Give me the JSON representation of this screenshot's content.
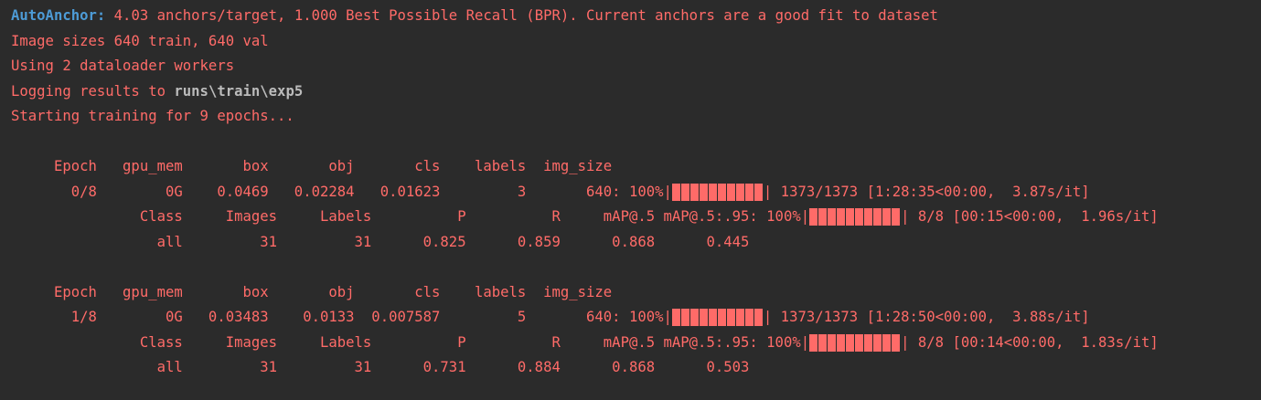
{
  "header": {
    "autoanchor_prefix": "AutoAnchor:",
    "autoanchor_msg": " 4.03 anchors/target, 1.000 Best Possible Recall (BPR). Current anchors are a good fit to dataset",
    "image_sizes": "Image sizes 640 train, 640 val",
    "workers": "Using 2 dataloader workers",
    "logging_prefix": "Logging results to ",
    "logging_path": "runs\\train\\exp5",
    "starting": "Starting training for 9 epochs..."
  },
  "epochs": [
    {
      "header_row": "     Epoch   gpu_mem       box       obj       cls    labels  img_size",
      "train_left": "       0/8        0G    0.0469   0.02284   0.01623         3       640: 100%|",
      "train_right": "| 1373/1373 [1:28:35<00:00,  3.87s/it]",
      "val_header_left": "               Class     Images     Labels          P          R     mAP@.5 mAP@.5:.95: 100%|",
      "val_header_right": "| 8/8 [00:15<00:00,  1.96s/it]",
      "val_row": "                 all         31         31      0.825      0.859      0.868      0.445"
    },
    {
      "header_row": "     Epoch   gpu_mem       box       obj       cls    labels  img_size",
      "train_left": "       1/8        0G   0.03483    0.0133  0.007587         5       640: 100%|",
      "train_right": "| 1373/1373 [1:28:50<00:00,  3.88s/it]",
      "val_header_left": "               Class     Images     Labels          P          R     mAP@.5 mAP@.5:.95: 100%|",
      "val_header_right": "| 8/8 [00:14<00:00,  1.83s/it]",
      "val_row": "                 all         31         31      0.731      0.884      0.868      0.503"
    }
  ],
  "progress": {
    "epoch0_train": 1.0,
    "epoch0_val": 1.0,
    "epoch1_train": 1.0,
    "epoch1_val": 1.0
  },
  "colors": {
    "background": "#2b2b2b",
    "stderr_text": "#ff6b68",
    "prefix_blue": "#4d9bd6",
    "path_gray": "#bbbbbb"
  }
}
